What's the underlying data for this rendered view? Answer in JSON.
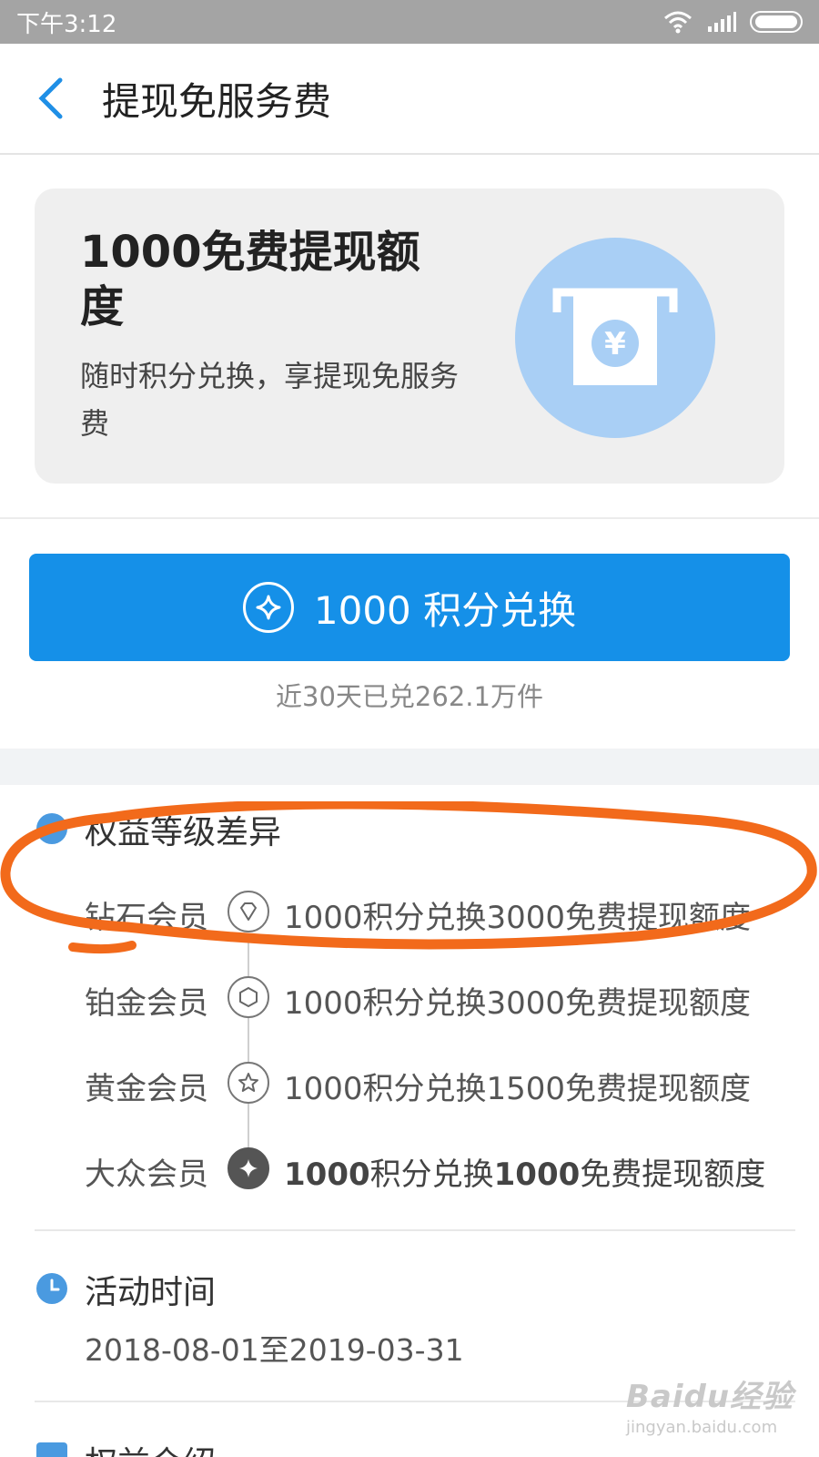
{
  "status_bar": {
    "time": "下午3:12"
  },
  "nav": {
    "back_icon": "chevron-left-icon",
    "title": "提现免服务费"
  },
  "hero": {
    "title": "1000免费提现额度",
    "subtitle": "随时积分兑换，享提现免服务费",
    "icon": "atm-yuan-icon",
    "icon_bg_color": "#a9cff5",
    "yuan_symbol": "¥"
  },
  "exchange": {
    "button_label": "1000 积分兑换",
    "button_color": "#1590e8",
    "redeemed_text": "近30天已兑262.1万件"
  },
  "levels": {
    "title": "权益等级差异",
    "items": [
      {
        "name": "钻石会员",
        "badge_icon": "diamond-icon",
        "desc": "1000积分兑换3000免费提现额度"
      },
      {
        "name": "铂金会员",
        "badge_icon": "hexagon-badge-icon",
        "desc": "1000积分兑换3000免费提现额度"
      },
      {
        "name": "黄金会员",
        "badge_icon": "star-icon",
        "desc": "1000积分兑换1500免费提现额度"
      },
      {
        "name": "大众会员",
        "badge_icon": "sparkle-icon",
        "desc_bold1": "1000",
        "desc_mid": "积分兑换",
        "desc_bold2": "1000",
        "desc_end": "免费提现额度",
        "current": true
      }
    ]
  },
  "activity_time": {
    "title": "活动时间",
    "value": "2018-08-01至2019-03-31"
  },
  "rules": {
    "title": "权益介绍"
  },
  "watermark": {
    "logo": "Baidu经验",
    "url": "jingyan.baidu.com"
  }
}
